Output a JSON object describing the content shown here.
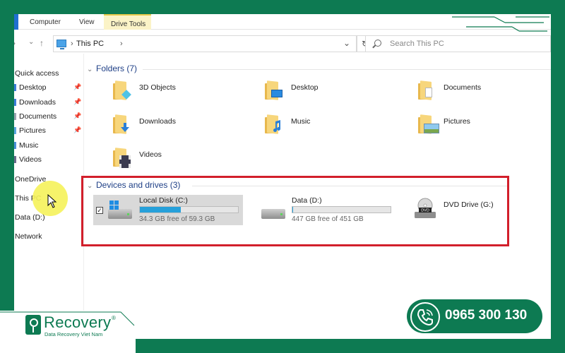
{
  "ribbon": {
    "tabs": [
      "Computer",
      "View",
      "Drive Tools"
    ]
  },
  "address": {
    "path": "This PC",
    "search_placeholder": "Search This PC"
  },
  "sidebar": {
    "quick_access": "Quick access",
    "pinned": [
      {
        "label": "Desktop",
        "pinned": true
      },
      {
        "label": "Downloads",
        "pinned": true
      },
      {
        "label": "Documents",
        "pinned": true
      },
      {
        "label": "Pictures",
        "pinned": true
      },
      {
        "label": "Music",
        "pinned": false
      },
      {
        "label": "Videos",
        "pinned": false
      }
    ],
    "onedrive": "OneDrive",
    "this_pc": "This PC",
    "data_d": "Data (D:)",
    "network": "Network"
  },
  "folders": {
    "header": "Folders (7)",
    "items": [
      "3D Objects",
      "Desktop",
      "Documents",
      "Downloads",
      "Music",
      "Pictures",
      "Videos"
    ]
  },
  "drives": {
    "header": "Devices and drives (3)",
    "items": [
      {
        "name": "Local Disk (C:)",
        "free": "34.3 GB free of 59.3 GB",
        "used_fraction": 0.42
      },
      {
        "name": "Data (D:)",
        "free": "447 GB free of 451 GB",
        "used_fraction": 0.01
      },
      {
        "name": "DVD Drive (G:)"
      }
    ]
  },
  "branding": {
    "logo_name": "Recovery",
    "logo_reg": "®",
    "logo_subtitle": "Data Recovery Viet Nam",
    "phone": "0965 300 130"
  },
  "colors": {
    "brand_green": "#0d7a52",
    "highlight_red": "#d21f2b",
    "drive_bar": "#26a0da"
  }
}
